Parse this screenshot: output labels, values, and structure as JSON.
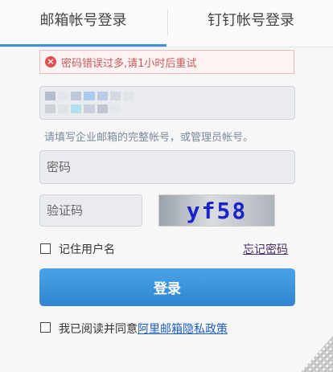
{
  "tabs": {
    "email_login": "邮箱帐号登录",
    "dingtalk_login": "钉钉帐号登录"
  },
  "error": {
    "message": "密码错误过多,请1小时后重试"
  },
  "account": {
    "placeholder": ""
  },
  "hint": "请填写企业邮箱的完整帐号，或管理员帐号。",
  "password": {
    "placeholder": "密码"
  },
  "captcha": {
    "placeholder": "验证码",
    "image_text": "yf58"
  },
  "remember": {
    "label": "记住用户名"
  },
  "forgot": {
    "label": "忘记密码"
  },
  "login_button": "登录",
  "agreement": {
    "prefix": "我已阅读并同意",
    "link": "阿里邮箱隐私政策"
  },
  "colors": {
    "accent": "#3b8fd6",
    "error_text": "#c85a5a",
    "captcha_text": "#1a22c9"
  }
}
